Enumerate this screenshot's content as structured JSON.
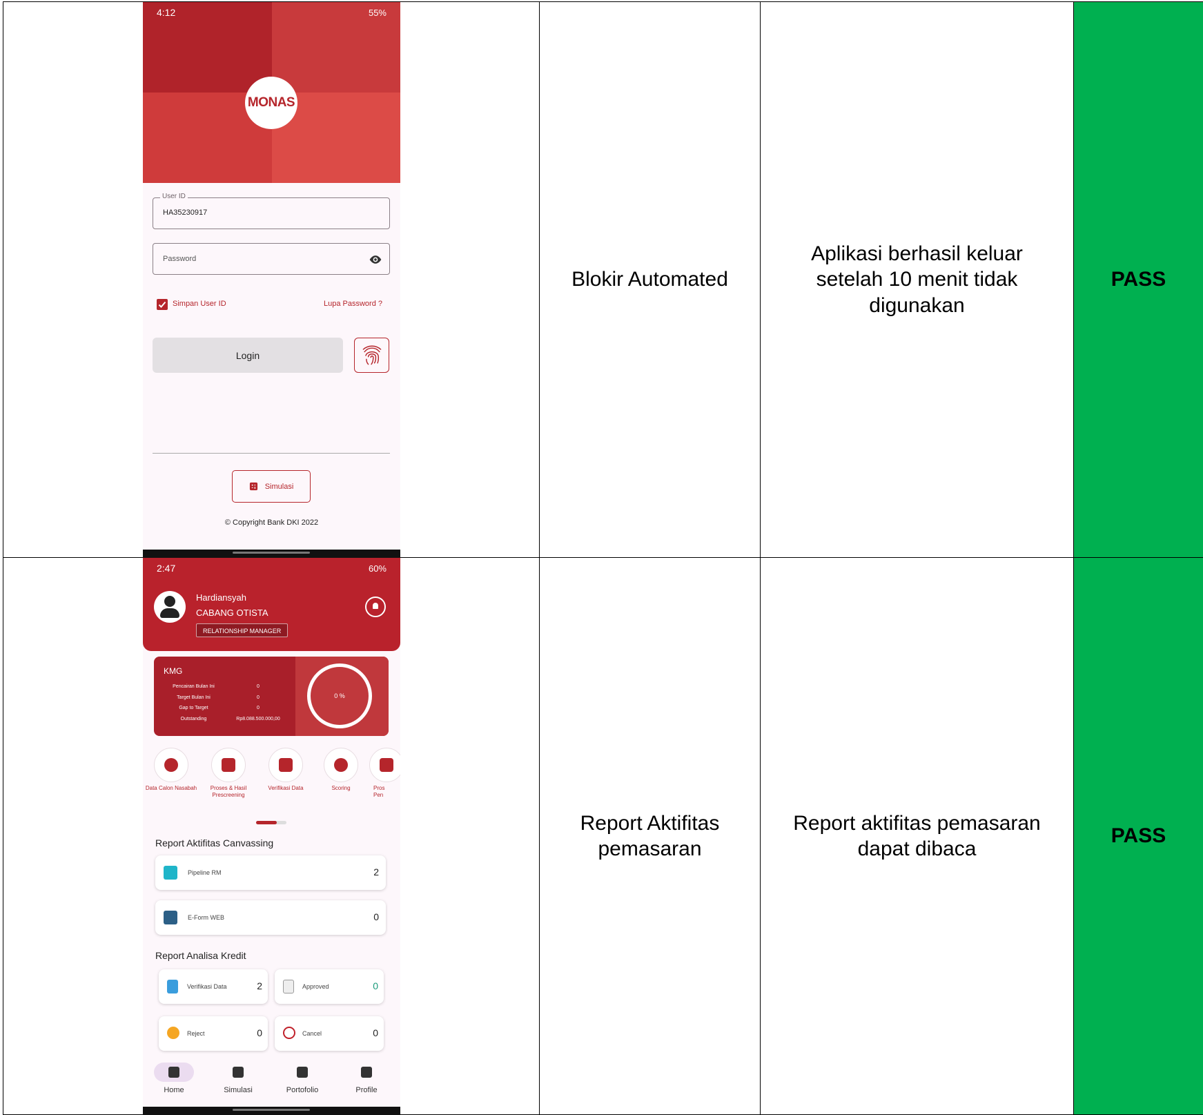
{
  "rows": [
    {
      "description": "Blokir Automated",
      "expected": "Aplikasi berhasil keluar setelah 10 menit tidak digunakan",
      "result": "PASS"
    },
    {
      "description": "Report Aktifitas pemasaran",
      "expected": "Report aktifitas pemasaran dapat dibaca",
      "result": "PASS"
    }
  ],
  "login_screen": {
    "status_time": "4:12",
    "status_battery": "55%",
    "logo_text": "MONAS",
    "userid_label": "User ID",
    "userid_value": "HA35230917",
    "password_placeholder": "Password",
    "remember_label": "Simpan User ID",
    "forgot_label": "Lupa Password ?",
    "login_label": "Login",
    "simulasi_label": "Simulasi",
    "copyright": "© Copyright Bank DKI 2022",
    "colors": {
      "brand": "#b5252b",
      "hero": "#c62a2d"
    }
  },
  "home_screen": {
    "status_time": "2:47",
    "status_battery": "60%",
    "user_name": "Hardiansyah",
    "branch": "CABANG OTISTA",
    "role": "RELATIONSHIP MANAGER",
    "kmg": {
      "title": "KMG",
      "rows": [
        {
          "label": "Pencairan Bulan Ini",
          "value": "0"
        },
        {
          "label": "Target Bulan Ini",
          "value": "0"
        },
        {
          "label": "Gap to Target",
          "value": "0"
        },
        {
          "label": "Outstanding",
          "value": "Rp8.088.500.000,00"
        }
      ],
      "percent": "0 %"
    },
    "menu": [
      {
        "label": "Data Calon Nasabah",
        "icon": "person-icon"
      },
      {
        "label": "Proses & Hasil Prescreening",
        "icon": "receipt-icon"
      },
      {
        "label": "Verifikasi Data",
        "icon": "document-icon"
      },
      {
        "label": "Scoring",
        "icon": "database-check-icon"
      },
      {
        "label": "Pros Pen",
        "icon": "more-icon"
      }
    ],
    "canvassing_title": "Report Aktifitas Canvassing",
    "canvassing": [
      {
        "label": "Pipeline RM",
        "count": "2"
      },
      {
        "label": "E-Form WEB",
        "count": "0"
      }
    ],
    "analisa_title": "Report Analisa Kredit",
    "analisa": [
      {
        "label": "Verifikasi Data",
        "count": "2"
      },
      {
        "label": "Approved",
        "count": "0"
      },
      {
        "label": "Reject",
        "count": "0"
      },
      {
        "label": "Cancel",
        "count": "0"
      }
    ],
    "bottom_nav": [
      "Home",
      "Simulasi",
      "Portofolio",
      "Profile"
    ]
  }
}
